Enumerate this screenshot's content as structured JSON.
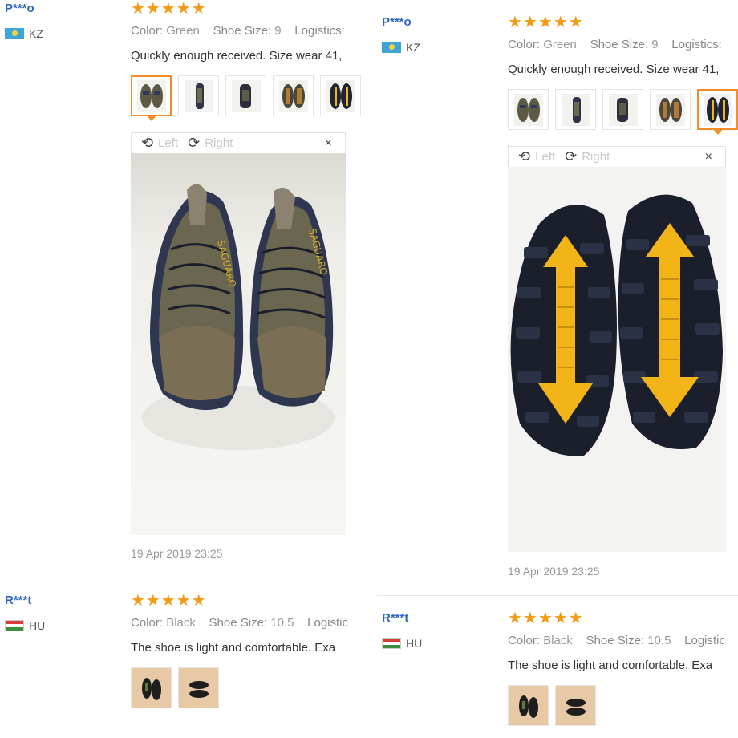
{
  "reviews": [
    {
      "user": "P***o",
      "country": "KZ",
      "stars": "★★★★★",
      "color_label": "Color:",
      "color_value": "Green",
      "size_label": "Shoe Size:",
      "size_value": "9",
      "logistics_label": "Logistics:",
      "text": "Quickly enough received. Size wear 41,",
      "date": "19 Apr 2019 23:25"
    },
    {
      "user": "R***t",
      "country": "HU",
      "stars": "★★★★★",
      "color_label": "Color:",
      "color_value": "Black",
      "size_label": "Shoe Size:",
      "size_value": "10.5",
      "logistics_label": "Logistic",
      "text": "The shoe is light and comfortable. Exa"
    }
  ],
  "viewer": {
    "left_label": "Left",
    "right_label": "Right",
    "close_glyph": "×",
    "rotate_left_glyph": "⟲",
    "rotate_right_glyph": "⟳"
  },
  "colors": {
    "username": "#2e66c4",
    "star": "#f39a14",
    "active_thumb": "#f38b2a"
  }
}
